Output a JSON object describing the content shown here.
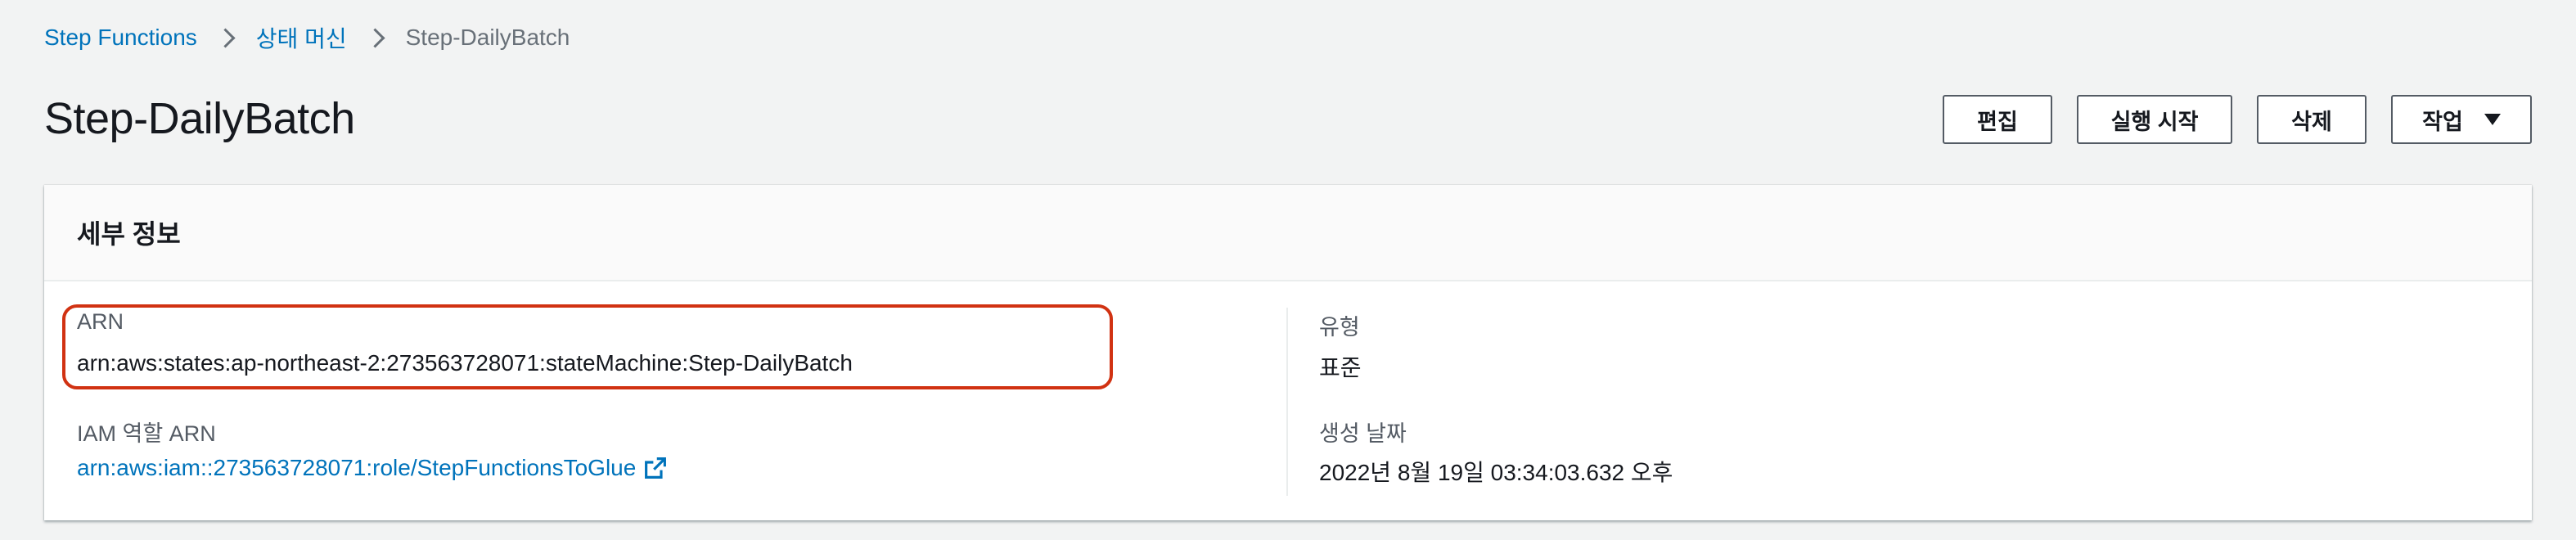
{
  "breadcrumb": {
    "items": [
      {
        "label": "Step Functions"
      },
      {
        "label": "상태 머신"
      },
      {
        "label": "Step-DailyBatch"
      }
    ]
  },
  "page": {
    "title": "Step-DailyBatch"
  },
  "actions": {
    "edit_label": "편집",
    "start_label": "실행 시작",
    "delete_label": "삭제",
    "actions_label": "작업"
  },
  "details": {
    "title": "세부 정보",
    "arn_label": "ARN",
    "arn_value": "arn:aws:states:ap-northeast-2:273563728071:stateMachine:Step-DailyBatch",
    "iam_label": "IAM 역할 ARN",
    "iam_value": "arn:aws:iam::273563728071:role/StepFunctionsToGlue",
    "type_label": "유형",
    "type_value": "표준",
    "created_label": "생성 날짜",
    "created_value": "2022년 8월 19일 03:34:03.632 오후"
  },
  "colors": {
    "link": "#0073bb",
    "highlight": "#d13212",
    "background": "#f2f3f3"
  },
  "icons": [
    "chevron-right-icon",
    "caret-down-icon",
    "external-link-icon"
  ]
}
